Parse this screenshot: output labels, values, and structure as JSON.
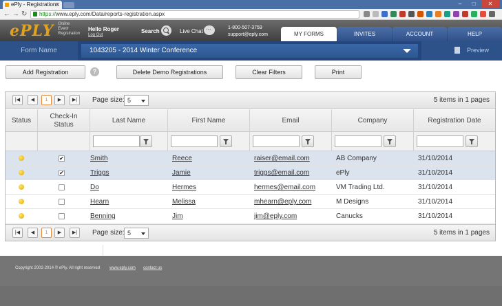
{
  "browser": {
    "tab_title": "ePly - Registrations",
    "url_scheme": "https://",
    "url_rest": "www.eply.com/Data/reports-registration.aspx"
  },
  "header": {
    "logo": "ePLY",
    "logo_sub": [
      "Online",
      "Event",
      "Registration"
    ],
    "greeting": "Hello Roger",
    "logout": "Log Out",
    "search_label": "Search",
    "chat_label": "Live Chat",
    "phone": "1-800-507-3759",
    "email": "support@eply.com",
    "tabs": [
      "MY FORMS",
      "INVITES",
      "ACCOUNT",
      "HELP"
    ],
    "active_tab": "MY FORMS"
  },
  "formbar": {
    "label": "Form Name",
    "selected": "1043205 - 2014 Winter Conference",
    "preview": "Preview"
  },
  "toolbar": {
    "add": "Add Registration",
    "help": "?",
    "delete_demo": "Delete Demo Registrations",
    "clear_filters": "Clear Filters",
    "print": "Print"
  },
  "pager": {
    "current_page": "1",
    "page_size_label": "Page size:",
    "page_size": "5",
    "items_info": "5 items in 1 pages"
  },
  "columns": [
    "Status",
    "Check-In Status",
    "Last Name",
    "First Name",
    "Email",
    "Company",
    "Registration Date"
  ],
  "rows": [
    {
      "checked": "✔",
      "last": "Smith",
      "first": "Reece",
      "email": "raiser@email.com",
      "company": "AB Company",
      "date": "31/10/2014"
    },
    {
      "checked": "✔",
      "last": "Triggs",
      "first": "Jamie",
      "email": "triggs@email.com",
      "company": "ePly",
      "date": "31/10/2014"
    },
    {
      "checked": "",
      "last": "Do",
      "first": "Hermes",
      "email": "hermes@email.com",
      "company": "VM Trading Ltd.",
      "date": "31/10/2014"
    },
    {
      "checked": "",
      "last": "Hearn",
      "first": "Melissa",
      "email": "mhearn@eply.com",
      "company": "M Designs",
      "date": "31/10/2014"
    },
    {
      "checked": "",
      "last": "Benning",
      "first": "Jim",
      "email": "jim@eply.com",
      "company": "Canucks",
      "date": "31/10/2014"
    }
  ],
  "footer": {
    "copyright": "Copyright 2002-2014 © ePly. All right reserved",
    "site_link": "www.eply.com",
    "contact_link": "contact us"
  },
  "colors": {
    "brand_orange": "#e1a21f",
    "nav_blue": "#22467d",
    "status_dot": "#f0c020"
  }
}
